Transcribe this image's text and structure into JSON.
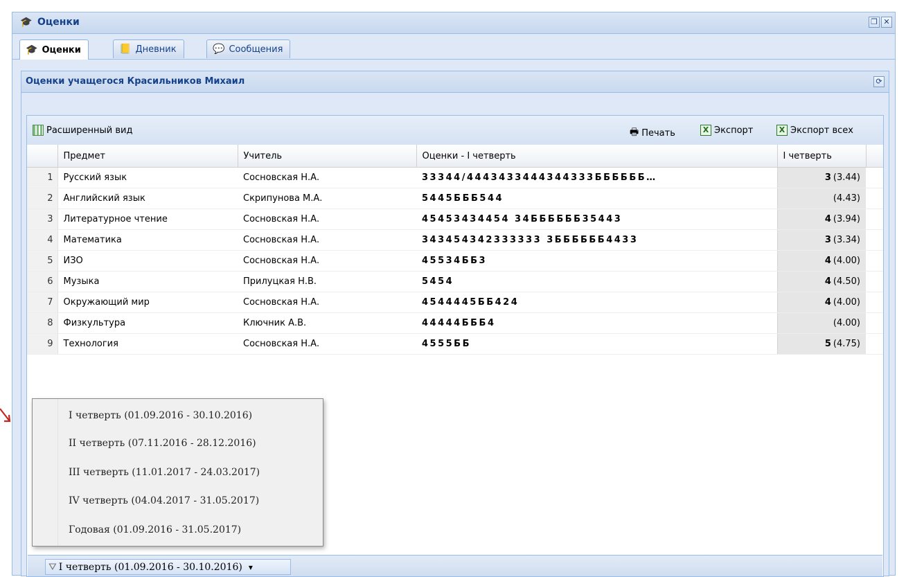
{
  "window": {
    "title": "Оценки",
    "restore_symbol": "❐",
    "close_symbol": "✕"
  },
  "tabs": [
    {
      "label": "Оценки",
      "icon": "graduation-cap-icon",
      "active": true
    },
    {
      "label": "Дневник",
      "icon": "diary-icon",
      "active": false
    },
    {
      "label": "Сообщения",
      "icon": "messages-icon",
      "active": false
    }
  ],
  "panel": {
    "title": "Оценки учащегося Красильников Михаил",
    "refresh_symbol": "⟳"
  },
  "toolbar": {
    "extended_view": "Расширенный вид",
    "print": "Печать",
    "export": "Экспорт",
    "export_all": "Экспорт всех"
  },
  "table": {
    "headers": [
      "Предмет",
      "Учитель",
      "Оценки - I четверть",
      "I четверть"
    ],
    "rows": [
      {
        "num": "1",
        "subject": "Русский язык",
        "teacher": "Сосновская Н.А.",
        "marks": "33344/4443433444344333ББББББ…",
        "grade": "3",
        "avg": "(3.44)"
      },
      {
        "num": "2",
        "subject": "Английский язык",
        "teacher": "Скрипунова М.А.",
        "marks": "5445БББ544",
        "grade": "",
        "avg": "(4.43)"
      },
      {
        "num": "3",
        "subject": "Литературное чтение",
        "teacher": "Сосновская Н.А.",
        "marks": "45453434454 34ББББББ35443",
        "grade": "4",
        "avg": "(3.94)"
      },
      {
        "num": "4",
        "subject": "Математика",
        "teacher": "Сосновская Н.А.",
        "marks": "343454342333333 3ББББББ4433",
        "grade": "3",
        "avg": "(3.34)"
      },
      {
        "num": "5",
        "subject": "ИЗО",
        "teacher": "Сосновская Н.А.",
        "marks": "45534ББ3",
        "grade": "4",
        "avg": "(4.00)"
      },
      {
        "num": "6",
        "subject": "Музыка",
        "teacher": "Прилуцкая Н.В.",
        "marks": "5454",
        "grade": "4",
        "avg": "(4.50)"
      },
      {
        "num": "7",
        "subject": "Окружающий мир",
        "teacher": "Сосновская Н.А.",
        "marks": "4544445ББ424",
        "grade": "4",
        "avg": "(4.00)"
      },
      {
        "num": "8",
        "subject": "Физкультура",
        "teacher": "Ключник А.В.",
        "marks": "44444БББ4",
        "grade": "",
        "avg": "(4.00)"
      },
      {
        "num": "9",
        "subject": "Технология",
        "teacher": "Сосновская Н.А.",
        "marks": "4555ББ",
        "grade": "5",
        "avg": "(4.75)"
      }
    ]
  },
  "period_menu": {
    "items": [
      "I четверть (01.09.2016 - 30.10.2016)",
      "II четверть (07.11.2016 - 28.12.2016)",
      "III четверть (11.01.2017 - 24.03.2017)",
      "IV четверть (04.04.2017 - 31.05.2017)",
      "Годовая (01.09.2016 - 31.05.2017)"
    ]
  },
  "period_selector": {
    "value": "I четверть (01.09.2016 - 30.10.2016)",
    "arrow": "▾"
  },
  "colors": {
    "panel_border": "#99bbe8",
    "title_blue": "#15428b",
    "annotation_arrow": "#c0281f"
  }
}
